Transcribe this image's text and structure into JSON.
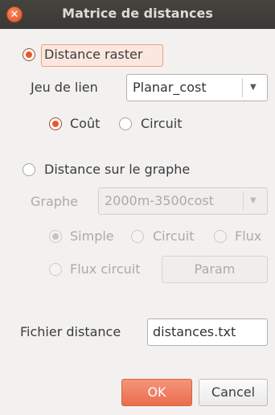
{
  "window": {
    "title": "Matrice de distances"
  },
  "raster": {
    "label": "Distance raster",
    "selected": true,
    "link_set_label": "Jeu de lien",
    "link_set_value": "Planar_cost",
    "cost_label": "Coût",
    "cost_selected": true,
    "circuit_label": "Circuit",
    "circuit_selected": false
  },
  "graph": {
    "label": "Distance sur le graphe",
    "selected": false,
    "graph_label": "Graphe",
    "graph_value": "2000m-3500cost",
    "options": {
      "simple": "Simple",
      "circuit": "Circuit",
      "flux": "Flux",
      "flux_circuit": "Flux circuit"
    },
    "param_button": "Param"
  },
  "file": {
    "label": "Fichier distance",
    "value": "distances.txt"
  },
  "buttons": {
    "ok": "OK",
    "cancel": "Cancel"
  },
  "colors": {
    "accent": "#e9582a",
    "titlebar": "#3c3b37"
  }
}
